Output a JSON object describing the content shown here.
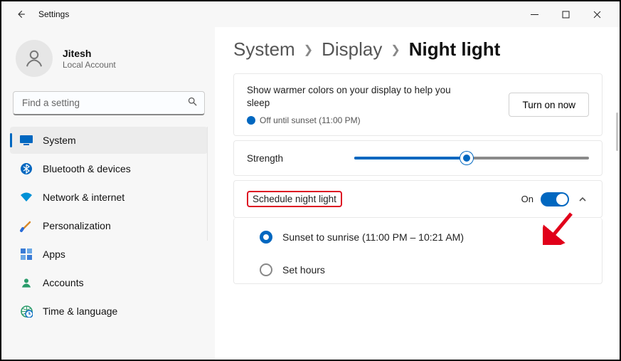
{
  "titlebar": {
    "title": "Settings"
  },
  "profile": {
    "name": "Jitesh",
    "sub": "Local Account"
  },
  "search": {
    "placeholder": "Find a setting"
  },
  "nav": [
    {
      "label": "System"
    },
    {
      "label": "Bluetooth & devices"
    },
    {
      "label": "Network & internet"
    },
    {
      "label": "Personalization"
    },
    {
      "label": "Apps"
    },
    {
      "label": "Accounts"
    },
    {
      "label": "Time & language"
    }
  ],
  "crumbs": {
    "a": "System",
    "b": "Display",
    "c": "Night light"
  },
  "card1": {
    "desc": "Show warmer colors on your display to help you sleep",
    "status": "Off until sunset (11:00 PM)",
    "button": "Turn on now"
  },
  "strength": {
    "label": "Strength",
    "percent": 48
  },
  "schedule": {
    "label": "Schedule night light",
    "state": "On"
  },
  "options": {
    "opt1": "Sunset to sunrise (11:00 PM – 10:21 AM)",
    "opt2": "Set hours"
  }
}
